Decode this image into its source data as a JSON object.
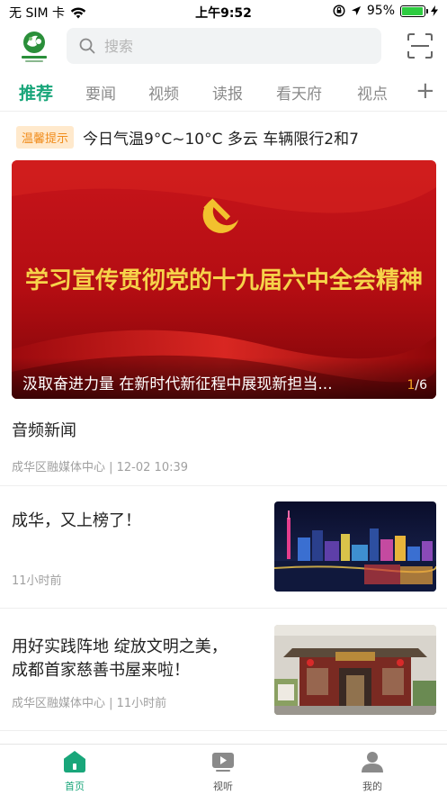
{
  "status_bar": {
    "carrier": "无 SIM 卡",
    "time": "上午9:52",
    "battery": "95%",
    "battery_level": 0.95
  },
  "header": {
    "logo_icon": "chenghua-logo-icon",
    "search_placeholder": "搜索",
    "scan_icon": "scan-icon"
  },
  "tabs": [
    {
      "label": "推荐",
      "active": true
    },
    {
      "label": "要闻",
      "active": false
    },
    {
      "label": "视频",
      "active": false
    },
    {
      "label": "读报",
      "active": false
    },
    {
      "label": "看天府",
      "active": false
    },
    {
      "label": "视点",
      "active": false
    }
  ],
  "tab_add": "+",
  "notice": {
    "badge": "温馨提示",
    "text": "今日气温9°C~10°C  多云  车辆限行2和7"
  },
  "banner": {
    "headline": "学习宣传贯彻党的十九届六中全会精神",
    "caption": "汲取奋进力量 在新时代新征程中展现新担当...",
    "pager_current": "1",
    "pager_total": "/6"
  },
  "news": [
    {
      "title": "音频新闻",
      "meta": "成华区融媒体中心 | 12-02 10:39"
    },
    {
      "title": "成华，又上榜了！",
      "meta": "11小时前",
      "thumb": "city-night-image"
    },
    {
      "title_line1": "用好实践阵地 绽放文明之美，",
      "title_line2": "成都首家慈善书屋来啦！",
      "meta": "成华区融媒体中心 | 11小时前",
      "thumb": "charity-bookhouse-image"
    }
  ],
  "bottom_nav": [
    {
      "label": "首页",
      "icon": "home-icon",
      "active": true
    },
    {
      "label": "视听",
      "icon": "video-play-icon",
      "active": false
    },
    {
      "label": "我的",
      "icon": "user-icon",
      "active": false
    }
  ],
  "colors": {
    "accent": "#19a67a",
    "notice_badge_bg": "#ffe9cc",
    "notice_badge_text": "#f08c1b"
  }
}
